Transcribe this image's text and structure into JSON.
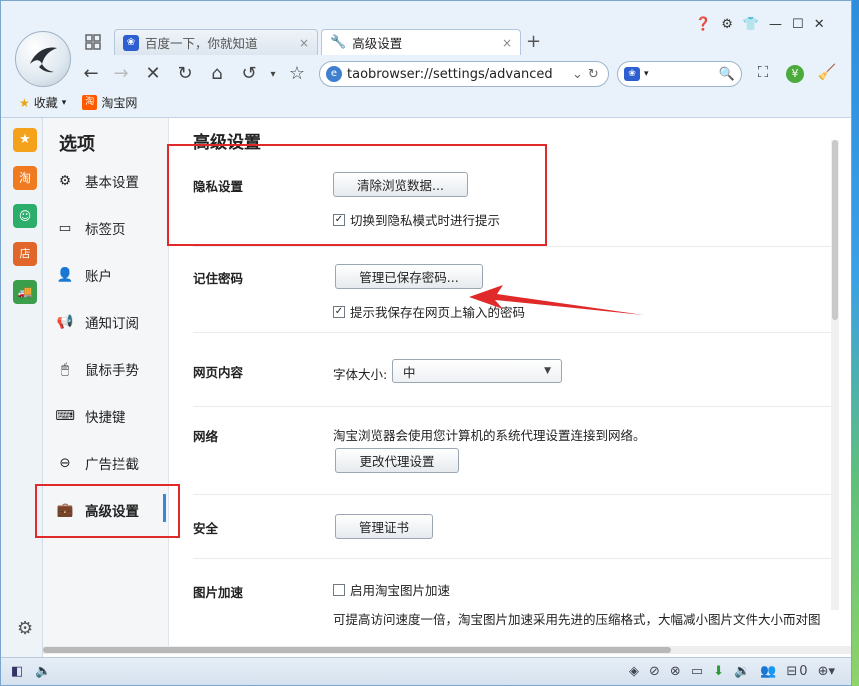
{
  "tabs": [
    {
      "label": "百度一下，你就知道",
      "close": "×",
      "active": false
    },
    {
      "label": "高级设置",
      "close": "×",
      "active": true
    }
  ],
  "new_tab_label": "+",
  "address": {
    "value": "taobrowser://settings/advanced"
  },
  "search": {
    "placeholder": ""
  },
  "bookmarks": [
    {
      "label": "收藏",
      "has_dropdown": true
    },
    {
      "label": "淘宝网"
    }
  ],
  "sidebar": {
    "title": "选项",
    "items": [
      {
        "label": "基本设置",
        "icon": "gear-icon"
      },
      {
        "label": "标签页",
        "icon": "tab-icon"
      },
      {
        "label": "账户",
        "icon": "user-icon"
      },
      {
        "label": "通知订阅",
        "icon": "megaphone-icon"
      },
      {
        "label": "鼠标手势",
        "icon": "mouse-icon"
      },
      {
        "label": "快捷键",
        "icon": "keyboard-icon"
      },
      {
        "label": "广告拦截",
        "icon": "adblock-icon"
      },
      {
        "label": "高级设置",
        "icon": "briefcase-icon",
        "selected": true
      }
    ]
  },
  "main": {
    "title": "高级设置",
    "privacy": {
      "label": "隐私设置",
      "clear_button": "清除浏览数据...",
      "checkbox_label": "切换到隐私模式时进行提示",
      "checkbox_checked": true
    },
    "password": {
      "label": "记住密码",
      "manage_button": "管理已保存密码...",
      "checkbox_label": "提示我保存在网页上输入的密码",
      "checkbox_checked": true
    },
    "webcontent": {
      "label": "网页内容",
      "font_size_label": "字体大小:",
      "font_size_value": "中"
    },
    "network": {
      "label": "网络",
      "description": "淘宝浏览器会使用您计算机的系统代理设置连接到网络。",
      "proxy_button": "更改代理设置"
    },
    "security": {
      "label": "安全",
      "cert_button": "管理证书"
    },
    "image_accel": {
      "label": "图片加速",
      "checkbox_label": "启用淘宝图片加速",
      "checkbox_checked": false,
      "description": "可提高访问速度一倍，淘宝图片加速采用先进的压缩格式，大幅减小图片文件大小而对图"
    }
  },
  "statusbar": {
    "download_count": "0"
  },
  "colors": {
    "highlight_red": "#e02a2a",
    "accent_blue": "#3a86d8"
  }
}
